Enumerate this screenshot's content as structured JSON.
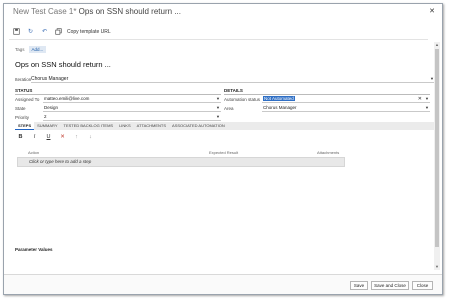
{
  "window": {
    "title_prefix": "New Test Case 1*",
    "title_main": "Ops on SSN should return ..."
  },
  "toolbar": {
    "copy_template_label": "Copy template URL"
  },
  "tags": {
    "label": "Tags",
    "add_label": "Add..."
  },
  "work_item": {
    "title": "Ops on SSN should return ...",
    "iteration_label": "Iteration",
    "iteration_value": "Chorus Manager"
  },
  "status": {
    "heading": "STATUS",
    "assigned_label": "Assigned To",
    "assigned_value": "matteo.emili@live.com",
    "state_label": "State",
    "state_value": "Design",
    "priority_label": "Priority",
    "priority_value": "2"
  },
  "details": {
    "heading": "DETAILS",
    "automation_label": "Automation status",
    "automation_value": "Not Automated",
    "area_label": "Area",
    "area_value": "Chorus Manager"
  },
  "tabs": [
    {
      "label": "STEPS"
    },
    {
      "label": "SUMMARY"
    },
    {
      "label": "TESTED BACKLOG ITEMS"
    },
    {
      "label": "LINKS"
    },
    {
      "label": "ATTACHMENTS"
    },
    {
      "label": "ASSOCIATED AUTOMATION"
    }
  ],
  "steps": {
    "col_action": "Action",
    "col_expected": "Expected Result",
    "col_attachments": "Attachments",
    "placeholder": "Click or type here to add a step"
  },
  "parameters": {
    "heading": "Parameter Values"
  },
  "buttons": {
    "save": "Save",
    "save_close": "Save and Close",
    "close": "Close"
  },
  "colors": {
    "accent": "#1f63c2",
    "selection": "#2f6fc5"
  }
}
